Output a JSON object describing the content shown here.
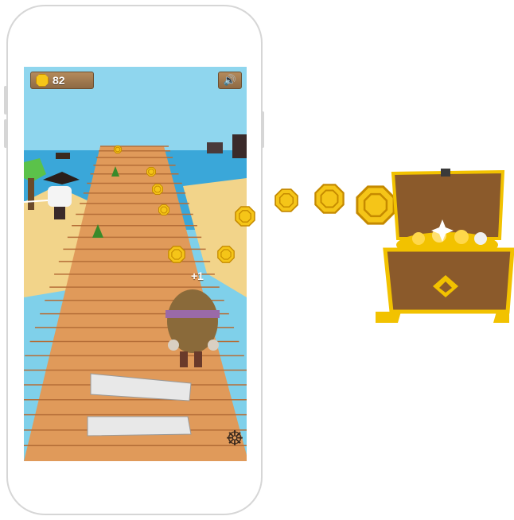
{
  "hud": {
    "coins_count": "82",
    "coin_icon": "coin-icon",
    "sound_icon": "speaker-icon"
  },
  "popup": {
    "plus_one": "+1"
  },
  "controls": {
    "settings_icon": "ship-wheel-icon",
    "settings_glyph": "☸"
  },
  "credit": "",
  "colors": {
    "sky": "#7fd0ea",
    "sea": "#3aa7d9",
    "sand": "#f2d48a",
    "plank": "#e09a5a",
    "plank_dark": "#b56e38",
    "coin": "#f5c518",
    "coin_edge": "#c58a00",
    "chest": "#8b5a2b",
    "chest_trim": "#f2c200"
  }
}
